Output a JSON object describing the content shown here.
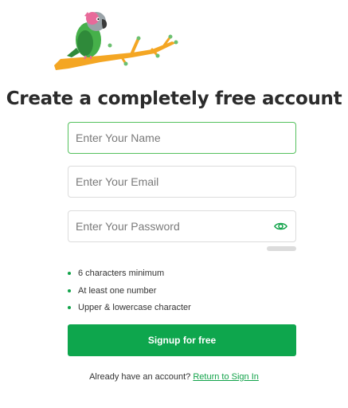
{
  "brand": {
    "logo_icon": "parrot-on-branch-icon"
  },
  "title": "Create a completely free account",
  "form": {
    "name": {
      "placeholder": "Enter Your Name",
      "value": ""
    },
    "email": {
      "placeholder": "Enter Your Email",
      "value": ""
    },
    "password": {
      "placeholder": "Enter Your Password",
      "value": "",
      "toggle_icon": "eye-icon"
    }
  },
  "password_strength": {
    "level": 0
  },
  "requirements": [
    "6 characters minimum",
    "At least one number",
    "Upper & lowercase character"
  ],
  "signup_button": "Signup for free",
  "signin": {
    "prompt": "Already have an account?",
    "link": "Return to Sign In"
  },
  "colors": {
    "accent": "#0ea64d",
    "focus_border": "#55c15e",
    "bullet": "#12a34a",
    "branch": "#f4a623"
  }
}
